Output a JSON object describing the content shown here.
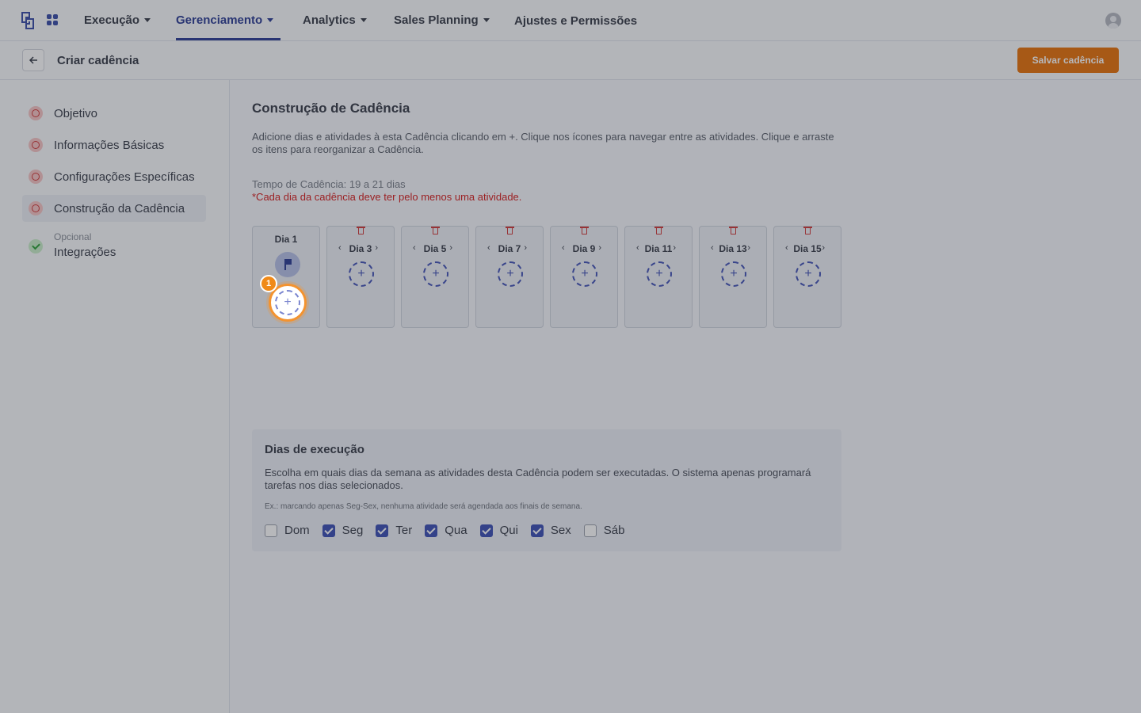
{
  "nav": {
    "items": [
      {
        "label": "Execução",
        "has_caret": true
      },
      {
        "label": "Gerenciamento",
        "has_caret": true,
        "active": true
      },
      {
        "label": "Analytics",
        "has_caret": true
      },
      {
        "label": "Sales Planning",
        "has_caret": true
      },
      {
        "label": "Ajustes e Permissões",
        "has_caret": false
      }
    ]
  },
  "subheader": {
    "title": "Criar cadência",
    "save_label": "Salvar cadência"
  },
  "sidebar": {
    "steps": [
      {
        "label": "Objetivo",
        "status": "error"
      },
      {
        "label": "Informações Básicas",
        "status": "error"
      },
      {
        "label": "Configurações Específicas",
        "status": "error"
      },
      {
        "label": "Construção da Cadência",
        "status": "error",
        "current": true
      },
      {
        "small": "Opcional",
        "label": "Integrações",
        "status": "ok"
      }
    ]
  },
  "main": {
    "title": "Construção de Cadência",
    "intro": "Adicione dias e atividades à esta Cadência clicando em +. Clique nos ícones para navegar entre as atividades. Clique e arraste os itens para reorganizar a Cadência.",
    "tempo": "Tempo de Cadência: 19 a 21 dias",
    "warning": "*Cada dia da cadência deve ter pelo menos uma atividade.",
    "days": [
      "Dia 1",
      "Dia 3",
      "Dia 5",
      "Dia 7",
      "Dia 9",
      "Dia 11",
      "Dia 13",
      "Dia 15"
    ],
    "add_symbol": "+",
    "arrow_left": "‹",
    "arrow_right": "›",
    "tour_badge": "1"
  },
  "execution": {
    "title": "Dias de execução",
    "desc": "Escolha em quais dias da semana as atividades desta Cadência podem ser executadas. O sistema apenas programará tarefas nos dias selecionados.",
    "note": "Ex.: marcando apenas Seg-Sex, nenhuma atividade será agendada aos finais de semana.",
    "weekdays": [
      {
        "label": "Dom",
        "checked": false
      },
      {
        "label": "Seg",
        "checked": true
      },
      {
        "label": "Ter",
        "checked": true
      },
      {
        "label": "Qua",
        "checked": true
      },
      {
        "label": "Qui",
        "checked": true
      },
      {
        "label": "Sex",
        "checked": true
      },
      {
        "label": "Sáb",
        "checked": false
      }
    ]
  },
  "icons": {
    "back": "arrow-left-icon",
    "user": "user-avatar-icon",
    "apps": "apps-grid-icon",
    "flag": "flag-icon",
    "trash": "trash-icon"
  },
  "colors": {
    "brand": "#2e3f95",
    "accent": "#e8740c",
    "error": "#d61f1f",
    "success": "#2fa33a"
  }
}
